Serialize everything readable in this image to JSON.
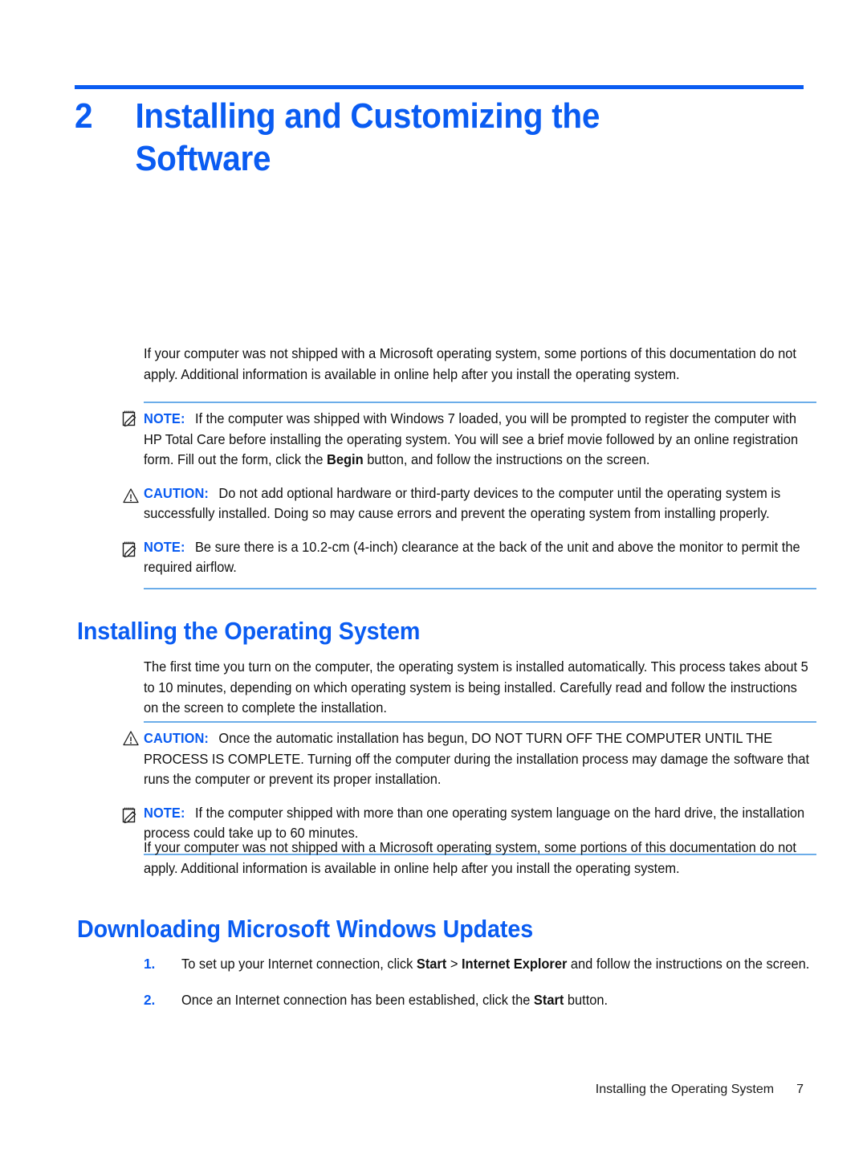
{
  "chapter": {
    "number": "2",
    "title_line1": "Installing and Customizing the",
    "title_line2": "Software",
    "accent_color": "#0a5cf2"
  },
  "paragraphs": {
    "intro": "If your computer was not shipped with a Microsoft operating system, some portions of this documentation do not apply. Additional information is available in online help after you install the operating system.",
    "os_install": "The first time you turn on the computer, the operating system is installed automatically. This process takes about 5 to 10 minutes, depending on which operating system is being installed. Carefully read and follow the instructions on the screen to complete the installation.",
    "intro_repeat": "If your computer was not shipped with a Microsoft operating system, some portions of this documentation do not apply. Additional information is available in online help after you install the operating system."
  },
  "admonitions": {
    "note_label": "NOTE:",
    "caution_label": "CAUTION:",
    "group1": [
      {
        "type": "note",
        "label": "NOTE:",
        "icon": "note-pencil-icon",
        "text_before_bold": "If the computer was shipped with Windows 7 loaded, you will be prompted to register the computer with HP Total Care before installing the operating system. You will see a brief movie followed by an online registration form. Fill out the form, click the ",
        "bold": "Begin",
        "text_after_bold": " button, and follow the instructions on the screen."
      },
      {
        "type": "caution",
        "label": "CAUTION:",
        "icon": "warning-triangle-icon",
        "text": "Do not add optional hardware or third-party devices to the computer until the operating system is successfully installed. Doing so may cause errors and prevent the operating system from installing properly."
      },
      {
        "type": "note",
        "label": "NOTE:",
        "icon": "note-pencil-icon",
        "text": "Be sure there is a 10.2-cm (4-inch) clearance at the back of the unit and above the monitor to permit the required airflow."
      }
    ],
    "group2": [
      {
        "type": "caution",
        "label": "CAUTION:",
        "icon": "warning-triangle-icon",
        "text": "Once the automatic installation has begun, DO NOT TURN OFF THE COMPUTER UNTIL THE PROCESS IS COMPLETE. Turning off the computer during the installation process may damage the software that runs the computer or prevent its proper installation."
      },
      {
        "type": "note",
        "label": "NOTE:",
        "icon": "note-pencil-icon",
        "text": "If the computer shipped with more than one operating system language on the hard drive, the installation process could take up to 60 minutes."
      }
    ]
  },
  "sections": {
    "installing_os": "Installing the Operating System",
    "downloading_updates": "Downloading Microsoft Windows Updates"
  },
  "procedure": [
    {
      "number": "1.",
      "text_before_bold1": "To set up your Internet connection, click ",
      "bold1": "Start",
      "separator": " > ",
      "bold2": "Internet Explorer",
      "text_after": " and follow the instructions on the screen."
    },
    {
      "number": "2.",
      "text_before_bold1": "Once an Internet connection has been established, click the ",
      "bold1": "Start",
      "text_after": " button."
    }
  ],
  "footer": {
    "running_head": "Installing the Operating System",
    "page_number": "7"
  }
}
